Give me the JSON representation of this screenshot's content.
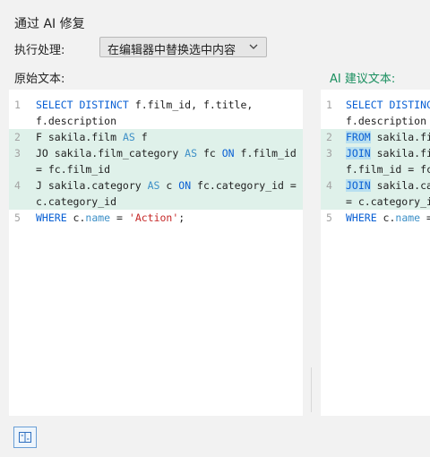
{
  "dialog": {
    "title": "通过 AI 修复",
    "action_label": "执行处理:",
    "action_value": "在编辑器中替换选中内容",
    "original_header": "原始文本:",
    "ai_header": "AI 建议文本:"
  },
  "original_code": [
    {
      "ln": "1",
      "parts": [
        [
          "kw",
          "SELECT DISTINCT"
        ],
        [
          "t",
          " f.film_id, f.title,"
        ]
      ]
    },
    {
      "ln": "",
      "parts": [
        [
          "t",
          "f.description"
        ]
      ]
    },
    {
      "ln": "2",
      "hl": true,
      "parts": [
        [
          "t",
          "F sakila.film "
        ],
        [
          "kw2",
          "AS"
        ],
        [
          "t",
          " f"
        ]
      ]
    },
    {
      "ln": "3",
      "hl": true,
      "parts": [
        [
          "t",
          "JO sakila.film_category "
        ],
        [
          "kw2",
          "AS"
        ],
        [
          "t",
          " fc "
        ],
        [
          "kw",
          "ON"
        ],
        [
          "t",
          " f.film_id"
        ]
      ]
    },
    {
      "ln": "",
      "hl": true,
      "parts": [
        [
          "t",
          "= fc.film_id"
        ]
      ]
    },
    {
      "ln": "4",
      "hl": true,
      "parts": [
        [
          "t",
          "J sakila.category "
        ],
        [
          "kw2",
          "AS"
        ],
        [
          "t",
          " c "
        ],
        [
          "kw",
          "ON"
        ],
        [
          "t",
          " fc.category_id ="
        ]
      ]
    },
    {
      "ln": "",
      "hl": true,
      "parts": [
        [
          "t",
          "c.category_id"
        ]
      ]
    },
    {
      "ln": "5",
      "parts": [
        [
          "kw",
          "WHERE"
        ],
        [
          "t",
          " c."
        ],
        [
          "kw2",
          "name"
        ],
        [
          "t",
          " = "
        ],
        [
          "str",
          "'Action'"
        ],
        [
          "t",
          ";"
        ]
      ]
    }
  ],
  "ai_code": [
    {
      "ln": "1",
      "parts": [
        [
          "kw",
          "SELECT DISTINC"
        ]
      ]
    },
    {
      "ln": "",
      "parts": [
        [
          "t",
          "f.description"
        ]
      ]
    },
    {
      "ln": "2",
      "hl": true,
      "parts": [
        [
          "kwd",
          "FROM"
        ],
        [
          "t",
          " sakila.fil"
        ]
      ]
    },
    {
      "ln": "3",
      "hl": true,
      "parts": [
        [
          "kwd",
          "JOIN"
        ],
        [
          "t",
          " sakila.fi"
        ]
      ]
    },
    {
      "ln": "",
      "hl": true,
      "parts": [
        [
          "t",
          "f.film_id = fc"
        ]
      ]
    },
    {
      "ln": "4",
      "hl": true,
      "parts": [
        [
          "kwd",
          "JOIN"
        ],
        [
          "t",
          " sakila.ca"
        ]
      ]
    },
    {
      "ln": "",
      "hl": true,
      "parts": [
        [
          "t",
          "= c.category_i"
        ]
      ]
    },
    {
      "ln": "5",
      "parts": [
        [
          "kw",
          "WHERE"
        ],
        [
          "t",
          " c."
        ],
        [
          "kw2",
          "name"
        ],
        [
          "t",
          " ="
        ]
      ]
    }
  ],
  "icons": {
    "select_chevron": "chevron-down-icon",
    "footer_button": "split-view-icon"
  }
}
